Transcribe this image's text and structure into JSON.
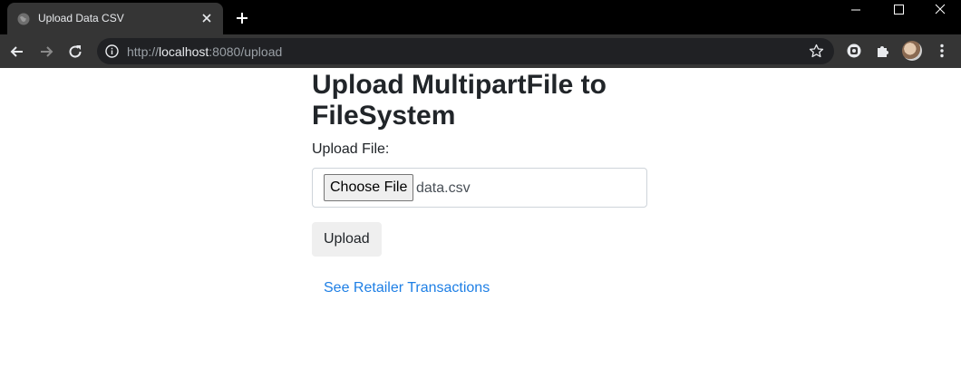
{
  "browser": {
    "tab_title": "Upload Data CSV",
    "url_scheme": "http://",
    "url_host": "localhost",
    "url_path": ":8080/upload"
  },
  "page": {
    "title": "Upload MultipartFile to FileSystem",
    "file_label": "Upload File:",
    "choose_file_label": "Choose File",
    "selected_file": "data.csv",
    "upload_label": "Upload",
    "link_text": "See Retailer Transactions"
  },
  "icons": {
    "favicon": "globe-icon",
    "tab_close": "close-icon",
    "new_tab": "plus-icon",
    "back": "arrow-left-icon",
    "forward": "arrow-right-icon",
    "reload": "reload-icon",
    "site_info": "info-icon",
    "bookmark": "star-icon",
    "extension": "extension-icon",
    "extensions_menu": "puzzle-icon",
    "menu": "kebab-menu-icon"
  },
  "colors": {
    "chrome_dark": "#000000",
    "toolbar": "#353535",
    "omnibox": "#202124",
    "link": "#1e7fe5",
    "text": "#212529"
  }
}
